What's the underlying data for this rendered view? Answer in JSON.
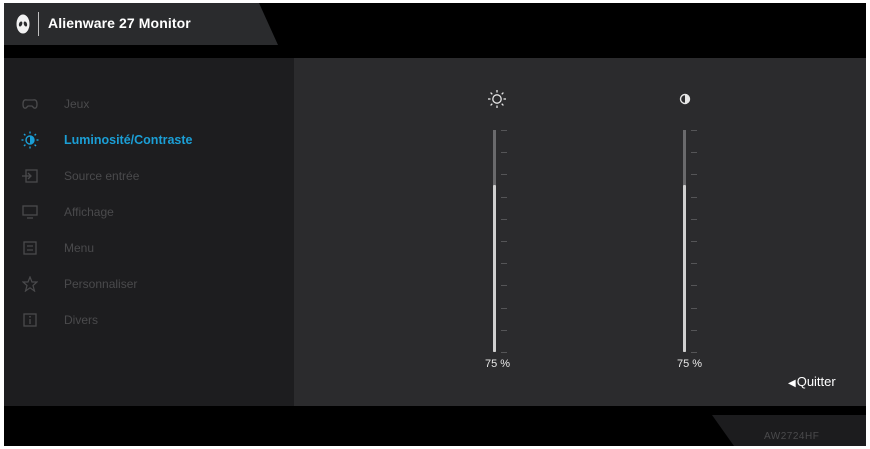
{
  "header": {
    "title": "Alienware 27 Monitor"
  },
  "menu": {
    "items": [
      {
        "label": "Jeux",
        "icon": "gamepad-icon",
        "active": false
      },
      {
        "label": "Luminosité/Contraste",
        "icon": "brightness-icon",
        "active": true
      },
      {
        "label": "Source entrée",
        "icon": "input-source-icon",
        "active": false
      },
      {
        "label": "Affichage",
        "icon": "display-icon",
        "active": false
      },
      {
        "label": "Menu",
        "icon": "menu-icon",
        "active": false
      },
      {
        "label": "Personnaliser",
        "icon": "star-icon",
        "active": false
      },
      {
        "label": "Divers",
        "icon": "info-icon",
        "active": false
      }
    ]
  },
  "brightness": {
    "icon": "sun-icon",
    "value": 75,
    "value_label": "75 %"
  },
  "contrast": {
    "icon": "contrast-icon",
    "value": 75,
    "value_label": "75 %"
  },
  "footer": {
    "exit_label": "Quitter",
    "model": "AW2724HF"
  },
  "colors": {
    "accent": "#1b9fd6",
    "inactive_text": "#4a4a4c",
    "background": "#000000"
  }
}
